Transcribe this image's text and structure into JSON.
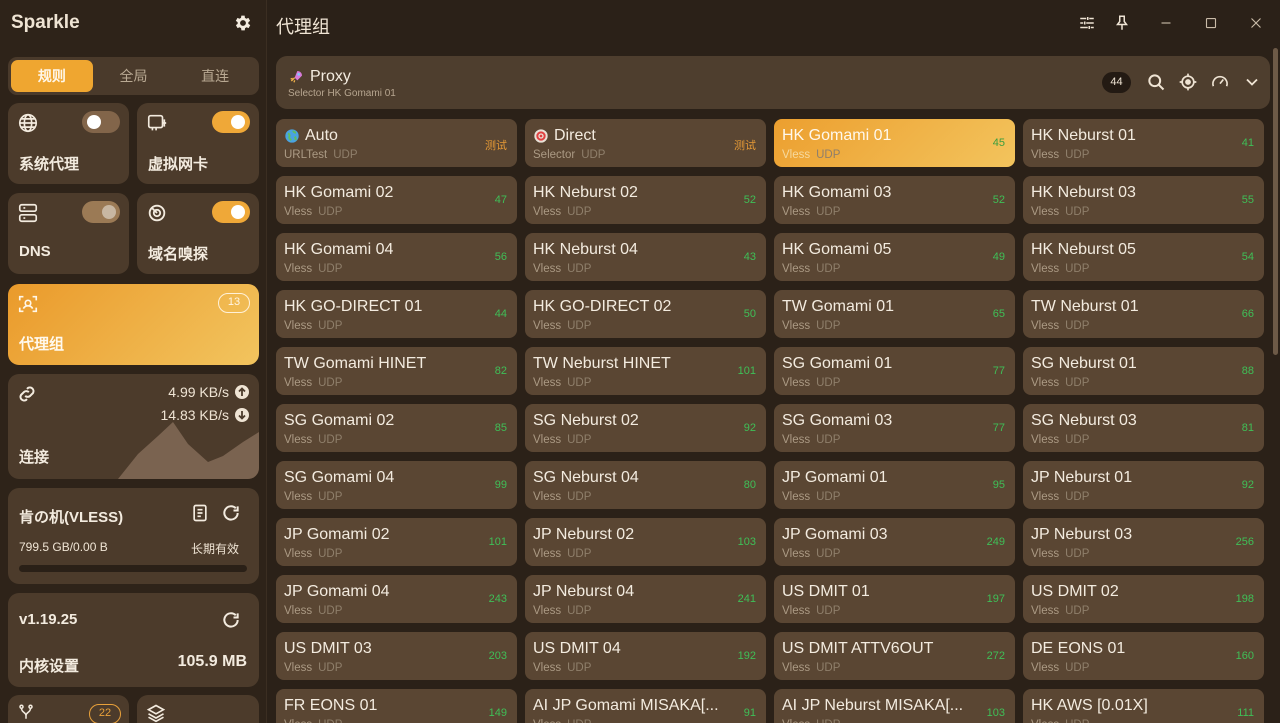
{
  "app": {
    "name": "Sparkle"
  },
  "mode_tabs": [
    "规则",
    "全局",
    "直连"
  ],
  "sidebar": {
    "system_proxy_label": "系统代理",
    "tun_label": "虚拟网卡",
    "dns_label": "DNS",
    "sniff_label": "域名嗅探",
    "proxy_groups_label": "代理组",
    "proxy_groups_count": "13",
    "connections_label": "连接",
    "upload_speed": "4.99 KB/s",
    "download_speed": "14.83 KB/s",
    "profile_name": "肯の机(VLESS)",
    "profile_usage": "799.5 GB/0.00 B",
    "profile_expire": "长期有效",
    "version": "v1.19.25",
    "core_settings_label": "内核设置",
    "core_memory": "105.9 MB",
    "rules_count": "22"
  },
  "main": {
    "title": "代理组",
    "group": {
      "name": "Proxy",
      "subtitle": "Selector HK Gomami 01",
      "count": "44"
    },
    "nodes": [
      {
        "name": "Auto",
        "type": "URLTest",
        "proto": "UDP",
        "latency": "",
        "test": "测试",
        "icon": "globe"
      },
      {
        "name": "Direct",
        "type": "Selector",
        "proto": "UDP",
        "latency": "",
        "test": "测试",
        "icon": "target"
      },
      {
        "name": "HK Gomami 01",
        "type": "Vless",
        "proto": "UDP",
        "latency": "45",
        "selected": true
      },
      {
        "name": "HK Neburst 01",
        "type": "Vless",
        "proto": "UDP",
        "latency": "41"
      },
      {
        "name": "HK Gomami 02",
        "type": "Vless",
        "proto": "UDP",
        "latency": "47"
      },
      {
        "name": "HK Neburst 02",
        "type": "Vless",
        "proto": "UDP",
        "latency": "52"
      },
      {
        "name": "HK Gomami 03",
        "type": "Vless",
        "proto": "UDP",
        "latency": "52"
      },
      {
        "name": "HK Neburst 03",
        "type": "Vless",
        "proto": "UDP",
        "latency": "55"
      },
      {
        "name": "HK Gomami 04",
        "type": "Vless",
        "proto": "UDP",
        "latency": "56"
      },
      {
        "name": "HK Neburst 04",
        "type": "Vless",
        "proto": "UDP",
        "latency": "43"
      },
      {
        "name": "HK Gomami 05",
        "type": "Vless",
        "proto": "UDP",
        "latency": "49"
      },
      {
        "name": "HK Neburst 05",
        "type": "Vless",
        "proto": "UDP",
        "latency": "54"
      },
      {
        "name": "HK GO-DIRECT 01",
        "type": "Vless",
        "proto": "UDP",
        "latency": "44"
      },
      {
        "name": "HK GO-DIRECT 02",
        "type": "Vless",
        "proto": "UDP",
        "latency": "50"
      },
      {
        "name": "TW Gomami 01",
        "type": "Vless",
        "proto": "UDP",
        "latency": "65"
      },
      {
        "name": "TW Neburst 01",
        "type": "Vless",
        "proto": "UDP",
        "latency": "66"
      },
      {
        "name": "TW Gomami HINET",
        "type": "Vless",
        "proto": "UDP",
        "latency": "82"
      },
      {
        "name": "TW Neburst HINET",
        "type": "Vless",
        "proto": "UDP",
        "latency": "101"
      },
      {
        "name": "SG Gomami 01",
        "type": "Vless",
        "proto": "UDP",
        "latency": "77"
      },
      {
        "name": "SG Neburst 01",
        "type": "Vless",
        "proto": "UDP",
        "latency": "88"
      },
      {
        "name": "SG Gomami 02",
        "type": "Vless",
        "proto": "UDP",
        "latency": "85"
      },
      {
        "name": "SG Neburst 02",
        "type": "Vless",
        "proto": "UDP",
        "latency": "92"
      },
      {
        "name": "SG Gomami 03",
        "type": "Vless",
        "proto": "UDP",
        "latency": "77"
      },
      {
        "name": "SG Neburst 03",
        "type": "Vless",
        "proto": "UDP",
        "latency": "81"
      },
      {
        "name": "SG Gomami 04",
        "type": "Vless",
        "proto": "UDP",
        "latency": "99"
      },
      {
        "name": "SG Neburst 04",
        "type": "Vless",
        "proto": "UDP",
        "latency": "80"
      },
      {
        "name": "JP Gomami 01",
        "type": "Vless",
        "proto": "UDP",
        "latency": "95"
      },
      {
        "name": "JP Neburst 01",
        "type": "Vless",
        "proto": "UDP",
        "latency": "92"
      },
      {
        "name": "JP Gomami 02",
        "type": "Vless",
        "proto": "UDP",
        "latency": "101"
      },
      {
        "name": "JP Neburst 02",
        "type": "Vless",
        "proto": "UDP",
        "latency": "103"
      },
      {
        "name": "JP Gomami 03",
        "type": "Vless",
        "proto": "UDP",
        "latency": "249"
      },
      {
        "name": "JP Neburst 03",
        "type": "Vless",
        "proto": "UDP",
        "latency": "256"
      },
      {
        "name": "JP Gomami 04",
        "type": "Vless",
        "proto": "UDP",
        "latency": "243"
      },
      {
        "name": "JP Neburst 04",
        "type": "Vless",
        "proto": "UDP",
        "latency": "241"
      },
      {
        "name": "US DMIT 01",
        "type": "Vless",
        "proto": "UDP",
        "latency": "197"
      },
      {
        "name": "US DMIT 02",
        "type": "Vless",
        "proto": "UDP",
        "latency": "198"
      },
      {
        "name": "US DMIT 03",
        "type": "Vless",
        "proto": "UDP",
        "latency": "203"
      },
      {
        "name": "US DMIT 04",
        "type": "Vless",
        "proto": "UDP",
        "latency": "192"
      },
      {
        "name": "US DMIT ATTV6OUT",
        "type": "Vless",
        "proto": "UDP",
        "latency": "272"
      },
      {
        "name": "DE EONS 01",
        "type": "Vless",
        "proto": "UDP",
        "latency": "160"
      },
      {
        "name": "FR EONS 01",
        "type": "Vless",
        "proto": "UDP",
        "latency": "149"
      },
      {
        "name": "AI JP Gomami MISAKA[...",
        "type": "Vless",
        "proto": "UDP",
        "latency": "91"
      },
      {
        "name": "AI JP Neburst MISAKA[...",
        "type": "Vless",
        "proto": "UDP",
        "latency": "103"
      },
      {
        "name": "HK AWS [0.01X]",
        "type": "Vless",
        "proto": "UDP",
        "latency": "111"
      }
    ]
  },
  "colors": {
    "accent": "#efa630",
    "latency_green": "#3fbf57",
    "card_bg": "#5a4633"
  }
}
